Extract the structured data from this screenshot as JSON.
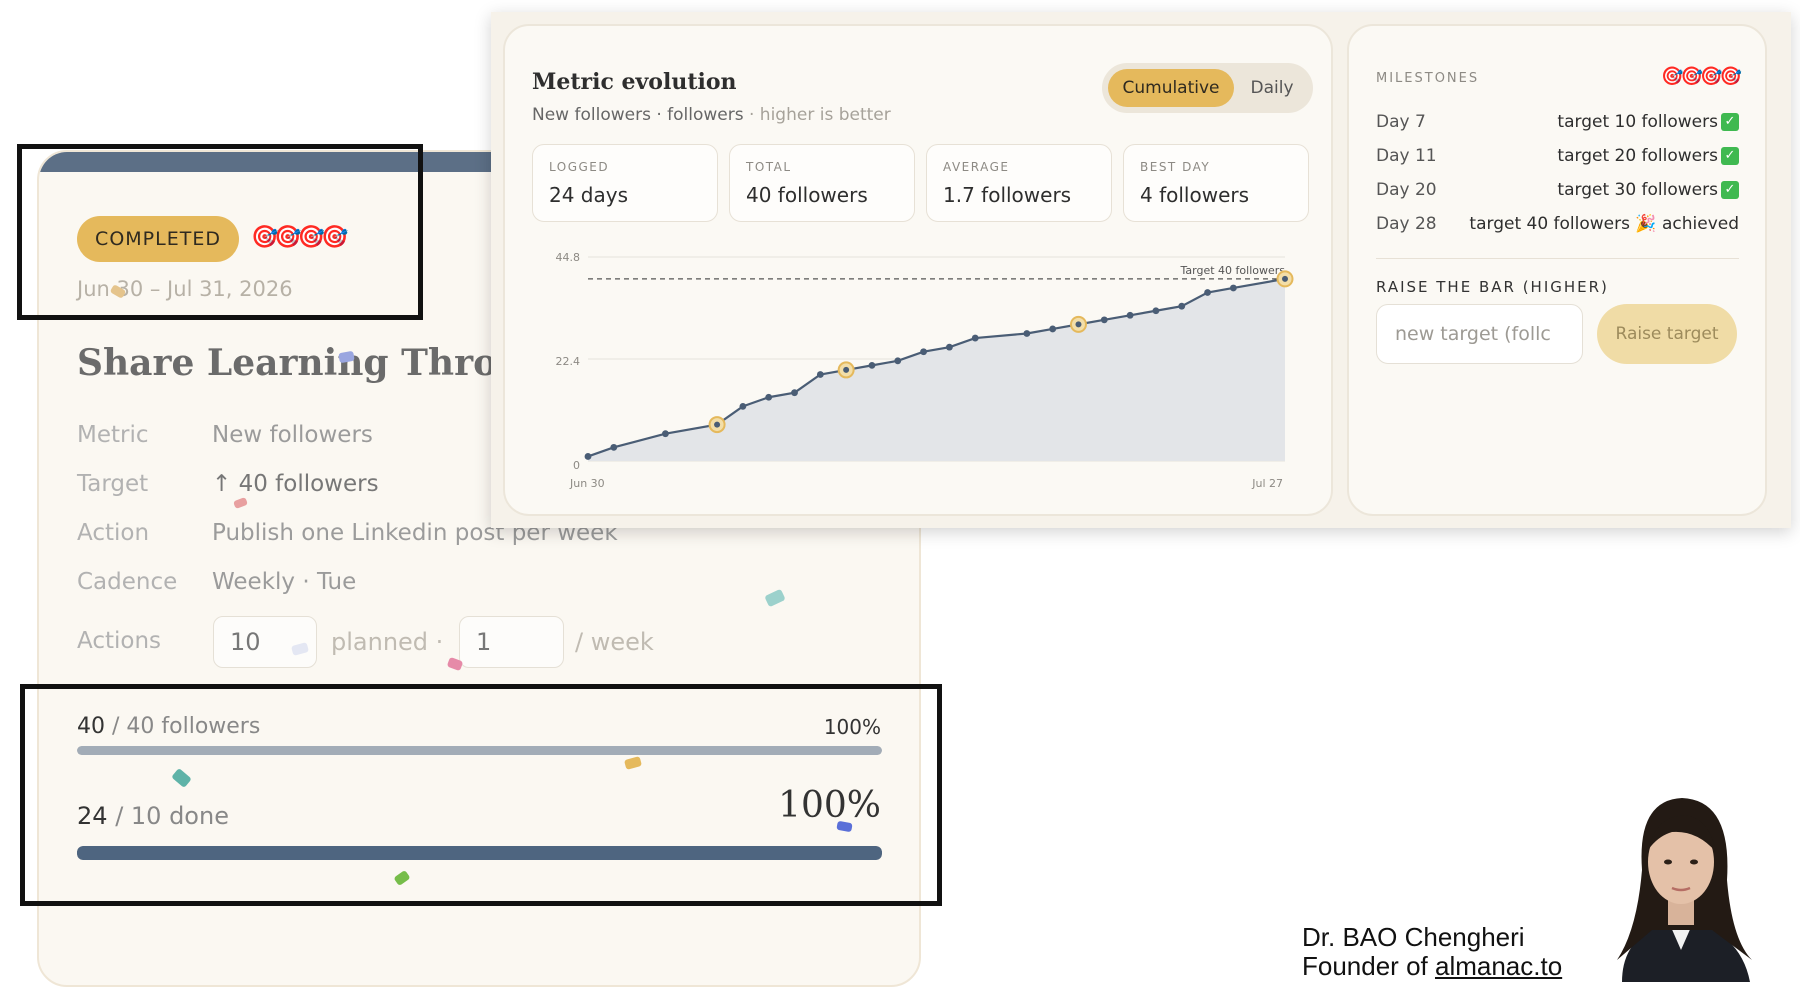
{
  "goal": {
    "status_badge": "COMPLETED",
    "target_icons": "🎯🎯🎯🎯",
    "date_range": "Jun 30 – Jul 31, 2026",
    "title": "Share Learning Throug",
    "rows": [
      {
        "label": "Metric",
        "value": "New followers"
      },
      {
        "label": "Target",
        "value": "↑ 40 followers"
      },
      {
        "label": "Action",
        "value": "Publish one Linkedin post per week"
      },
      {
        "label": "Cadence",
        "value": "Weekly · Tue"
      }
    ],
    "actions": {
      "label": "Actions",
      "planned_value": "10",
      "planned_label": "planned ·",
      "per_week_value": "1",
      "per_week_label": "/ week"
    },
    "progress_metric": {
      "current": "40",
      "rest": "/ 40 followers",
      "percent_label": "100%",
      "fraction": 1.0,
      "color": "#a2acb7"
    },
    "progress_actions": {
      "current": "24",
      "rest": "/ 10 done",
      "percent_label": "100%",
      "fraction": 1.0,
      "color": "#4e6580"
    }
  },
  "metric_evolution": {
    "title": "Metric evolution",
    "subtitle": "New followers · followers",
    "subtitle_note": "· higher is better",
    "toggle": {
      "active": "Cumulative",
      "inactive": "Daily"
    },
    "stats": [
      {
        "label": "LOGGED",
        "value": "24 days"
      },
      {
        "label": "TOTAL",
        "value": "40 followers"
      },
      {
        "label": "AVERAGE",
        "value": "1.7 followers"
      },
      {
        "label": "BEST DAY",
        "value": "4 followers"
      }
    ]
  },
  "chart_data": {
    "type": "area",
    "x_labels": [
      "Jun 30",
      "Jul 27"
    ],
    "y_ticks": [
      "44.8",
      "22.4",
      "0"
    ],
    "ylim": [
      0,
      44.8
    ],
    "target_line": {
      "value": 40,
      "label": "Target 40 followers"
    },
    "series": [
      {
        "x": [
          0,
          1,
          3,
          5,
          6,
          7,
          8,
          9,
          10,
          11,
          12,
          13,
          14,
          15,
          17,
          18,
          19,
          20,
          21,
          22,
          23,
          24,
          25,
          27
        ],
        "values": [
          1,
          3,
          6,
          8,
          12,
          14,
          15,
          19,
          20,
          21,
          22,
          24,
          25,
          27,
          28,
          29,
          30,
          31,
          32,
          33,
          34,
          37,
          38,
          40
        ],
        "milestones_at": [
          5,
          10,
          19,
          27
        ]
      }
    ],
    "colors": {
      "line": "#4a5d75",
      "area": "#e3e5e8",
      "milestone": "#e5b95c"
    }
  },
  "milestones": {
    "heading": "MILESTONES",
    "icons": "🎯🎯🎯🎯",
    "items": [
      {
        "day": "Day 7",
        "target": "target 10 followers",
        "mark": "✓"
      },
      {
        "day": "Day 11",
        "target": "target 20 followers",
        "mark": "✓"
      },
      {
        "day": "Day 20",
        "target": "target 30 followers",
        "mark": "✓"
      },
      {
        "day": "Day 28",
        "target": "target 40 followers 🎉 achieved",
        "mark": ""
      }
    ],
    "raise_heading": "RAISE THE BAR (HIGHER)",
    "raise_placeholder": "new target (follc",
    "raise_button": "Raise target"
  },
  "presenter": {
    "name": "Dr. BAO Chengheri",
    "role_prefix": "Founder of ",
    "role_link": "almanac.to"
  }
}
